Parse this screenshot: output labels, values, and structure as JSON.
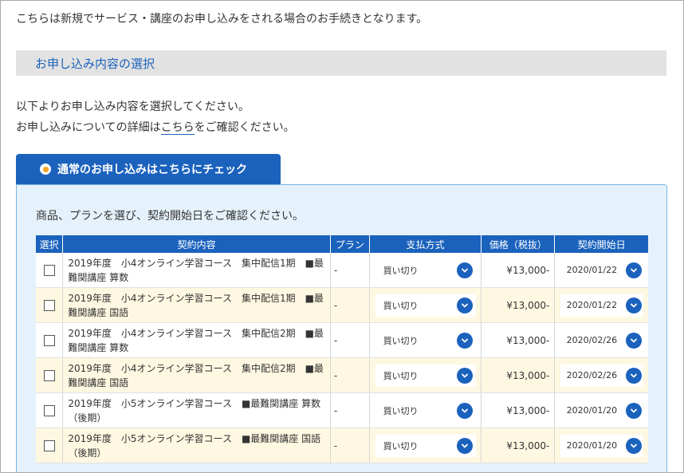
{
  "intro": "こちらは新規でサービス・講座のお申し込みをされる場合のお手続きとなります。",
  "section_title": "お申し込み内容の選択",
  "desc": {
    "line1": "以下よりお申し込み内容を選択してください。",
    "line2_before": "お申し込みについての詳細は",
    "line2_link": "こちら",
    "line2_after": "をご確認ください。"
  },
  "tab_label": "通常のお申し込みはこちらにチェック",
  "panel_text": "商品、プランを選び、契約開始日をご確認ください。",
  "table": {
    "headers": [
      "選択",
      "契約内容",
      "プラン",
      "支払方式",
      "価格（税抜）",
      "契約開始日"
    ],
    "rows": [
      {
        "name": "2019年度　小4オンライン学習コース　集中配信1期　■最難関講座 算数",
        "plan": "-",
        "pay": "買い切り",
        "price": "¥13,000-",
        "date": "2020/01/22"
      },
      {
        "name": "2019年度　小4オンライン学習コース　集中配信1期　■最難関講座 国語",
        "plan": "-",
        "pay": "買い切り",
        "price": "¥13,000-",
        "date": "2020/01/22"
      },
      {
        "name": "2019年度　小4オンライン学習コース　集中配信2期　■最難関講座 算数",
        "plan": "-",
        "pay": "買い切り",
        "price": "¥13,000-",
        "date": "2020/02/26"
      },
      {
        "name": "2019年度　小4オンライン学習コース　集中配信2期　■最難関講座 国語",
        "plan": "-",
        "pay": "買い切り",
        "price": "¥13,000-",
        "date": "2020/02/26"
      },
      {
        "name": "2019年度　小5オンライン学習コース　■最難関講座 算数（後期）",
        "plan": "-",
        "pay": "買い切り",
        "price": "¥13,000-",
        "date": "2020/01/20"
      },
      {
        "name": "2019年度　小5オンライン学習コース　■最難関講座 国語（後期）",
        "plan": "-",
        "pay": "買い切り",
        "price": "¥13,000-",
        "date": "2020/01/20"
      }
    ]
  },
  "colors": {
    "accent": "#1b62bd",
    "row_alt": "#fef8e2",
    "panel_bg": "#e6f2fb",
    "radio_dot": "#f5a623"
  },
  "icons": {
    "dropdown": "chevron-down-icon",
    "radio": "radio-selected-icon"
  }
}
